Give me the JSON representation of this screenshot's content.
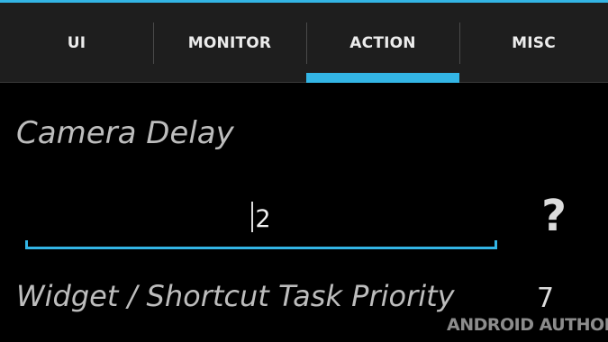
{
  "tabs": [
    {
      "label": "UI"
    },
    {
      "label": "MONITOR"
    },
    {
      "label": "ACTION",
      "selected": true
    },
    {
      "label": "MISC"
    }
  ],
  "camera_delay": {
    "label": "Camera Delay",
    "value": "2"
  },
  "help": {
    "icon": "question-mark-icon",
    "glyph": "?"
  },
  "widget_priority": {
    "label": "Widget / Shortcut Task Priority",
    "value": "7"
  },
  "watermark": "ANDROID AUTHORITY",
  "colors": {
    "accent": "#33b5e5",
    "background": "#000000",
    "tabbar": "#1e1e1e"
  }
}
